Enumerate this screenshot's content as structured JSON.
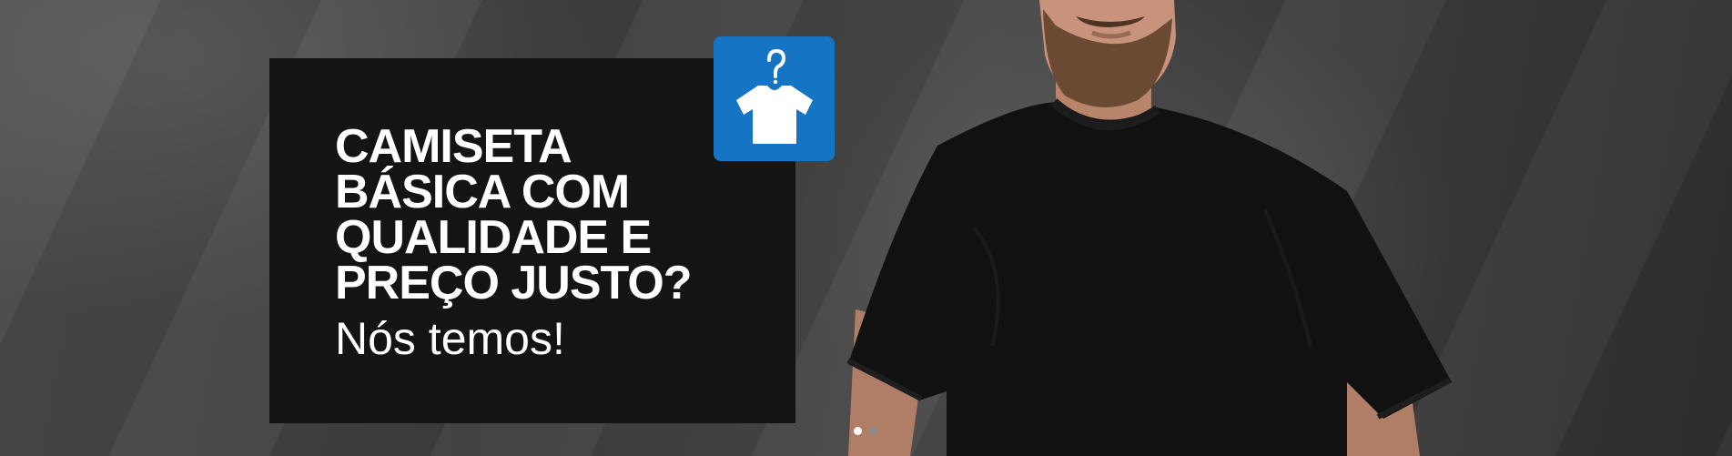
{
  "banner": {
    "headline_lines": [
      "CAMISETA",
      "BÁSICA COM",
      "QUALIDADE E",
      "PREÇO JUSTO?"
    ],
    "subline": "Nós temos!",
    "icon": "tshirt-hanger-question-icon",
    "icon_badge_color": "#1574c4",
    "text_box_color": "#141414"
  },
  "carousel": {
    "slide_count": 2,
    "active_index": 0
  }
}
